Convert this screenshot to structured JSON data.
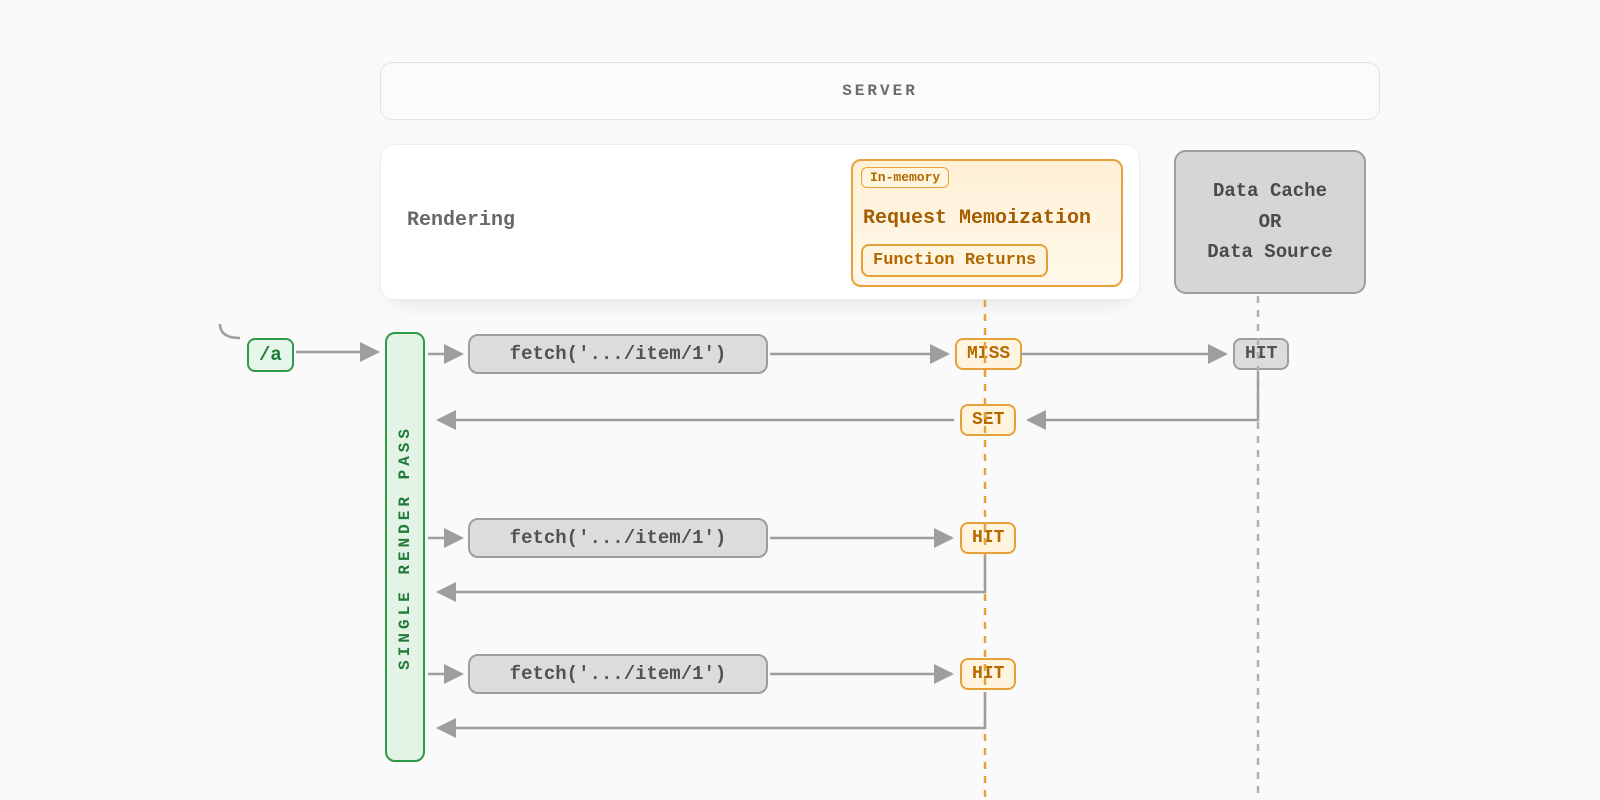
{
  "header": {
    "server_label": "SERVER"
  },
  "render": {
    "label": "Rendering",
    "memo_tag": "In-memory",
    "memo_title": "Request Memoization",
    "memo_sub": "Function Returns"
  },
  "cache": {
    "label": "Data Cache\nOR\nData Source"
  },
  "route": {
    "path": "/a"
  },
  "vbar": {
    "label": "SINGLE RENDER PASS"
  },
  "fetches": [
    {
      "code": "fetch('.../item/1')"
    },
    {
      "code": "fetch('.../item/1')"
    },
    {
      "code": "fetch('.../item/1')"
    }
  ],
  "chips": {
    "miss": "MISS",
    "set": "SET",
    "hit": "HIT"
  },
  "chart_data": {
    "type": "flow-diagram",
    "title": "Request Memoization flow within a single server render pass",
    "route": "/a",
    "memoization_scope": "SINGLE RENDER PASS",
    "memoization_label": "Request Memoization (In-memory, Function Returns)",
    "downstream": "Data Cache OR Data Source",
    "calls": [
      {
        "call": "fetch('.../item/1')",
        "memo_result": "MISS",
        "downstream_result": "HIT",
        "then": "SET"
      },
      {
        "call": "fetch('.../item/1')",
        "memo_result": "HIT"
      },
      {
        "call": "fetch('.../item/1')",
        "memo_result": "HIT"
      }
    ]
  }
}
